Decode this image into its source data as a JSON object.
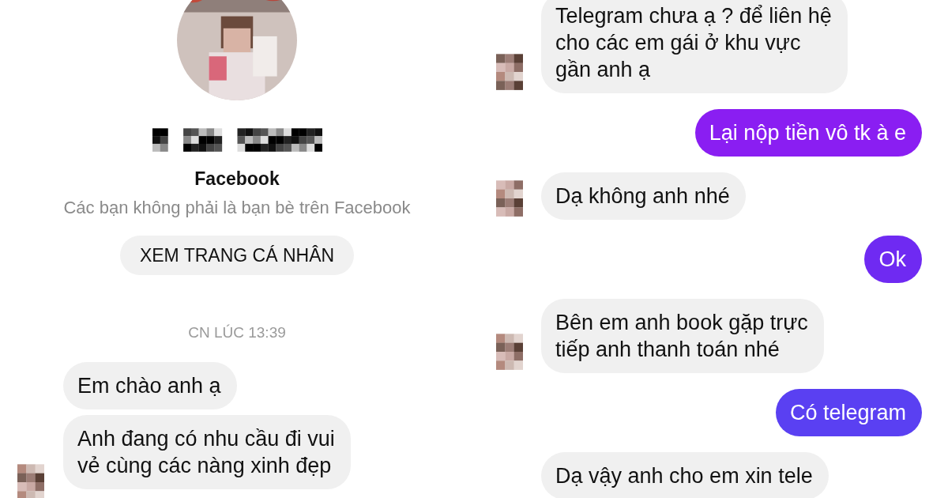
{
  "left": {
    "profile": {
      "network": "Facebook",
      "relation": "Các bạn không phải là bạn bè trên Facebook",
      "profile_button": "XEM TRANG CÁ NHÂN"
    },
    "timestamp": "CN LÚC 13:39",
    "messages": [
      {
        "kind": "incoming",
        "avatar": false,
        "lines": [
          "Em chào anh ạ"
        ]
      },
      {
        "kind": "incoming",
        "avatar": true,
        "lines": [
          "Anh đang có nhu cầu đi vui",
          "vẻ cùng các nàng xinh đẹp"
        ]
      }
    ]
  },
  "right": {
    "messages": [
      {
        "kind": "incoming",
        "avatar": true,
        "lines": [
          "Telegram chưa ạ ? để liên hệ",
          "cho các em gái ở khu vực",
          "gần anh ạ"
        ]
      },
      {
        "kind": "outgoing",
        "color": "#8a1ef2",
        "lines": [
          "Lại nộp tiền vô tk à e"
        ]
      },
      {
        "kind": "incoming",
        "avatar": true,
        "lines": [
          "Dạ không anh nhé"
        ]
      },
      {
        "kind": "outgoing",
        "color": "#6f2af2",
        "lines": [
          "Ok"
        ]
      },
      {
        "kind": "incoming",
        "avatar": true,
        "lines": [
          "Bên em anh book gặp trực",
          "tiếp anh thanh toán nhé"
        ]
      },
      {
        "kind": "outgoing",
        "color": "#5a40f2",
        "lines": [
          "Có telegram"
        ]
      },
      {
        "kind": "incoming",
        "avatar": false,
        "lines": [
          "Dạ vậy anh cho em xin tele"
        ]
      }
    ]
  }
}
